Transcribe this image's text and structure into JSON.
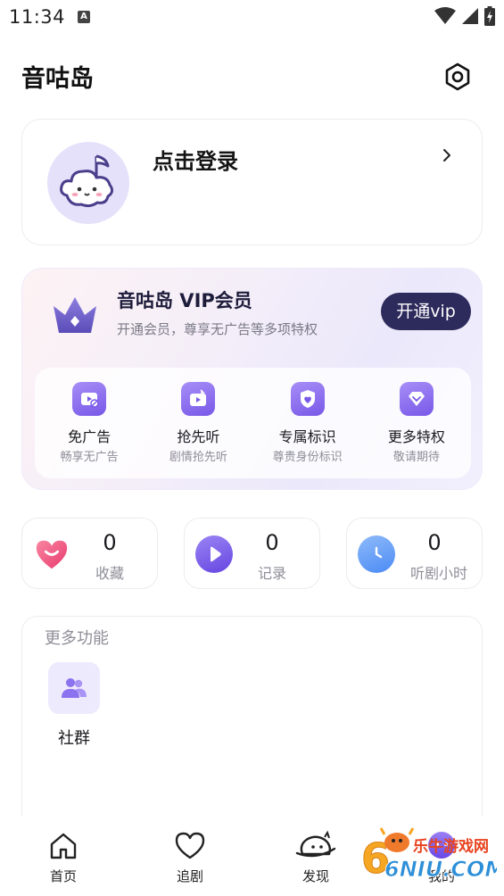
{
  "status_bar": {
    "time": "11:34",
    "notification_badge": "A"
  },
  "header": {
    "title": "音咕岛",
    "settings_icon": "gear-hexagon-icon"
  },
  "login": {
    "label": "点击登录",
    "avatar_icon": "cloud-mascot-icon"
  },
  "vip": {
    "title": "音咕岛 VIP会员",
    "subtitle": "开通会员，尊享无广告等多项特权",
    "button": "开通vip",
    "benefits": [
      {
        "name": "免广告",
        "desc": "畅享无广告",
        "icon": "no-ads-icon"
      },
      {
        "name": "抢先听",
        "desc": "剧情抢先听",
        "icon": "early-listen-icon"
      },
      {
        "name": "专属标识",
        "desc": "尊贵身份标识",
        "icon": "badge-shield-icon"
      },
      {
        "name": "更多特权",
        "desc": "敬请期待",
        "icon": "diamond-icon"
      }
    ]
  },
  "stats": [
    {
      "value": "0",
      "label": "收藏",
      "icon": "heart-icon",
      "color": "#ef4f7a"
    },
    {
      "value": "0",
      "label": "记录",
      "icon": "play-icon",
      "color": "#7759e8"
    },
    {
      "value": "0",
      "label": "听剧小时",
      "icon": "clock-icon",
      "color": "#4b8bf5"
    }
  ],
  "more": {
    "title": "更多功能",
    "features": [
      {
        "label": "社群",
        "icon": "group-icon"
      }
    ]
  },
  "tabs": [
    {
      "label": "首页",
      "icon": "home-icon"
    },
    {
      "label": "追剧",
      "icon": "heart-outline-icon"
    },
    {
      "label": "发现",
      "icon": "planet-mascot-icon"
    },
    {
      "label": "我的",
      "icon": "profile-mascot-icon"
    }
  ],
  "watermark": {
    "brand": "乐牛游戏网",
    "domain": "6NIU.COM"
  },
  "colors": {
    "accent": "#7858e8",
    "vip_button": "#2d2a5c"
  }
}
